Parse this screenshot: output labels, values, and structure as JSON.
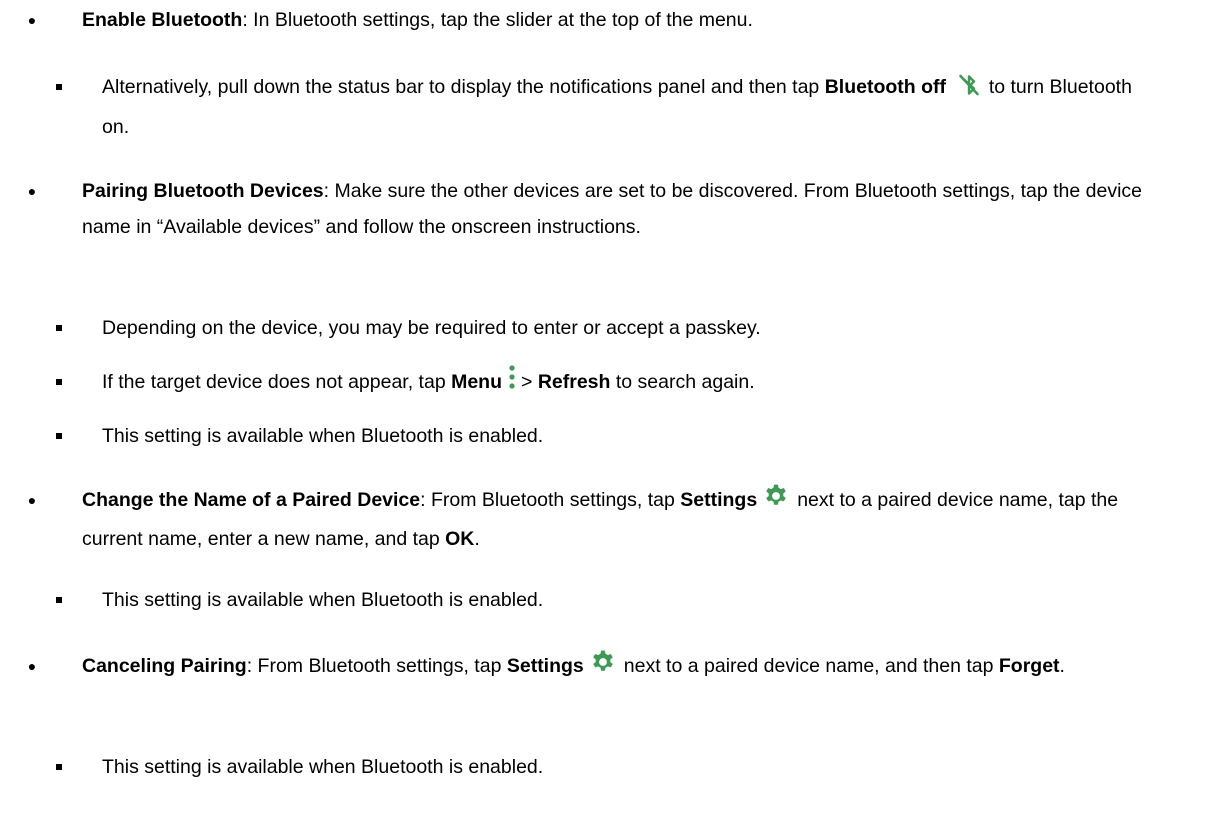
{
  "bullets": {
    "enable_bluetooth": {
      "term": "Enable Bluetooth",
      "text": ": In Bluetooth settings, tap the slider at the top of the menu.",
      "sub": {
        "alternatively": {
          "text_before": "Alternatively, pull down the status bar to display the notifications panel and then tap",
          "bold": "Bluetooth off",
          "icon": "bluetooth-off-icon",
          "text_after": "to turn Bluetooth on."
        }
      }
    },
    "pairing": {
      "term": "Pairing Bluetooth Devices",
      "text": ": Make sure the other devices are set to be discovered. From Bluetooth settings, tap the device name in “Available devices” and follow the onscreen instructions.",
      "sub": {
        "passkey": {
          "text": "Depending on the device, you may be required to enter or accept a passkey."
        },
        "refresh": {
          "text_before": "If the target device does not appear, tap",
          "menu_label": "Menu",
          "icon": "overflow-menu-icon",
          "separator": ">",
          "refresh_label": "Refresh",
          "text_after": "to search again."
        },
        "note": {
          "text": "This setting is available when Bluetooth is enabled."
        }
      }
    },
    "rename": {
      "term": "Change the Name of a Paired Device",
      "text_before": ": From Bluetooth settings, tap",
      "settings_label": "Settings",
      "icon": "settings-gear-icon",
      "text_after": "next to a paired device name, tap the current name, enter a new name, and tap",
      "ok_label": "OK",
      "end": ".",
      "sub": {
        "note": {
          "text": "This setting is available when Bluetooth is enabled."
        }
      }
    },
    "cancel": {
      "term": "Canceling Pairing",
      "text_before": ": From Bluetooth settings, tap",
      "settings_label": "Settings",
      "icon": "settings-gear-icon",
      "text_after": "next to a paired device name, and then tap",
      "forget_label": "Forget",
      "end": ".",
      "sub": {
        "note": {
          "text": "This setting is available when Bluetooth is enabled."
        }
      }
    }
  },
  "colors": {
    "text": "#000000",
    "icon": "#3c9a55"
  },
  "markers": {
    "level1": "●"
  }
}
